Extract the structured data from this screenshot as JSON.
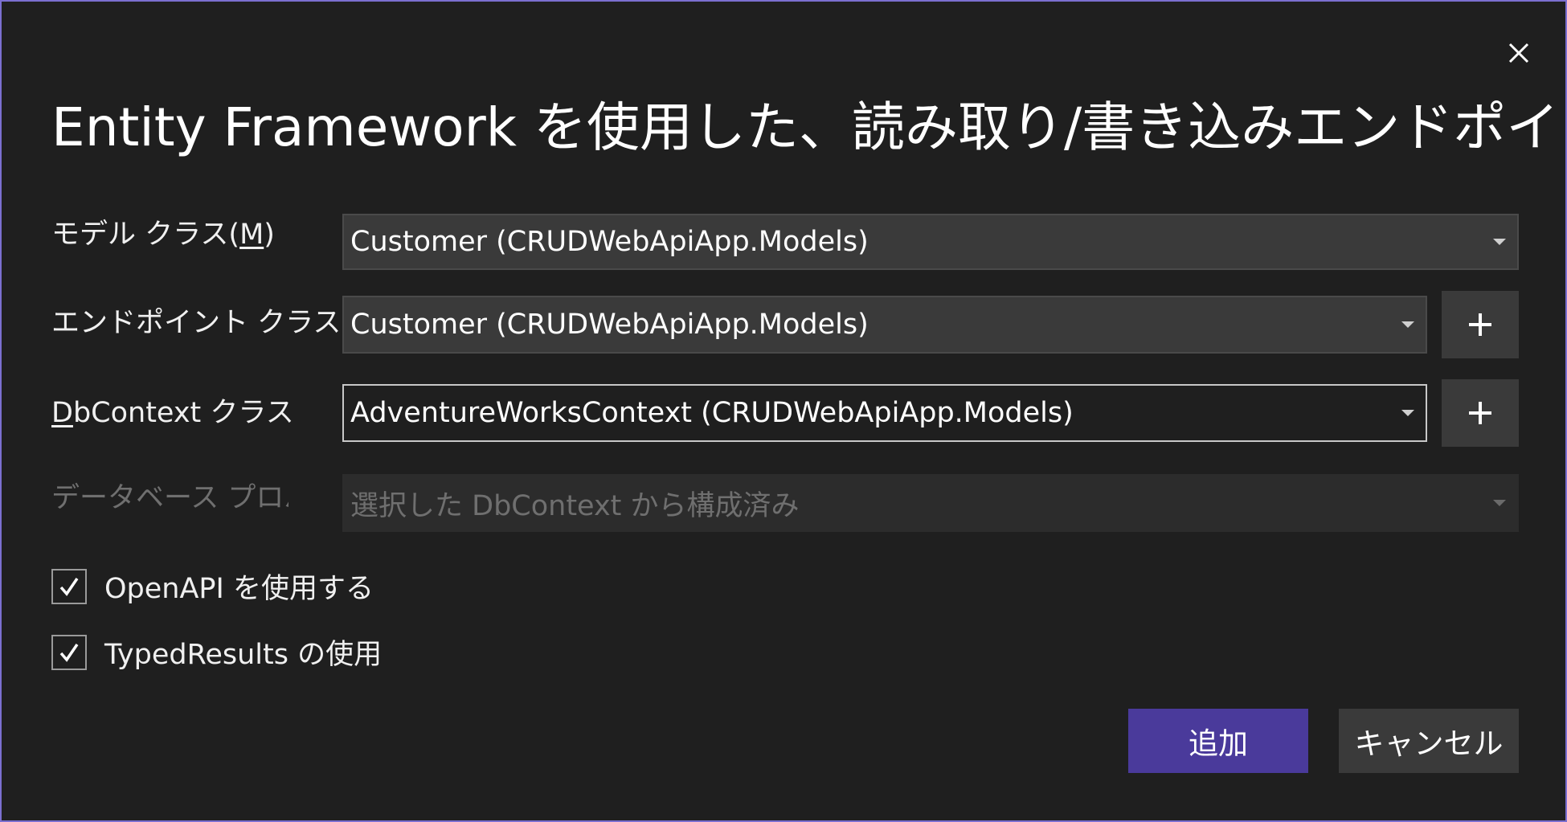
{
  "dialog": {
    "title": "Entity Framework を使用した、読み取り/書き込みエンドポイントを使用する API",
    "close_icon": "close-icon"
  },
  "fields": {
    "model_class": {
      "label_pre": "モデル クラス(",
      "label_access": "M",
      "label_post": ")",
      "value": "Customer (CRUDWebApiApp.Models)"
    },
    "endpoint_class": {
      "label": "エンドポイント クラス",
      "value": "Customer (CRUDWebApiApp.Models)",
      "add_icon": "plus-icon"
    },
    "dbcontext_class": {
      "label_access": "D",
      "label_post": "bContext クラス",
      "value": "AdventureWorksContext (CRUDWebApiApp.Models)",
      "add_icon": "plus-icon"
    },
    "database_provider": {
      "label": "データベース プロバイダー",
      "value": "選択した DbContext から構成済み",
      "disabled": true
    }
  },
  "options": {
    "openapi": {
      "label": "OpenAPI を使用する",
      "checked": true
    },
    "typed_results": {
      "label": "TypedResults の使用",
      "checked": true
    }
  },
  "buttons": {
    "add": "追加",
    "cancel": "キャンセル"
  },
  "colors": {
    "background": "#1f1f1f",
    "border_accent": "#7b6fd0",
    "primary_button": "#4a3a9b",
    "control": "#3a3a3a"
  }
}
